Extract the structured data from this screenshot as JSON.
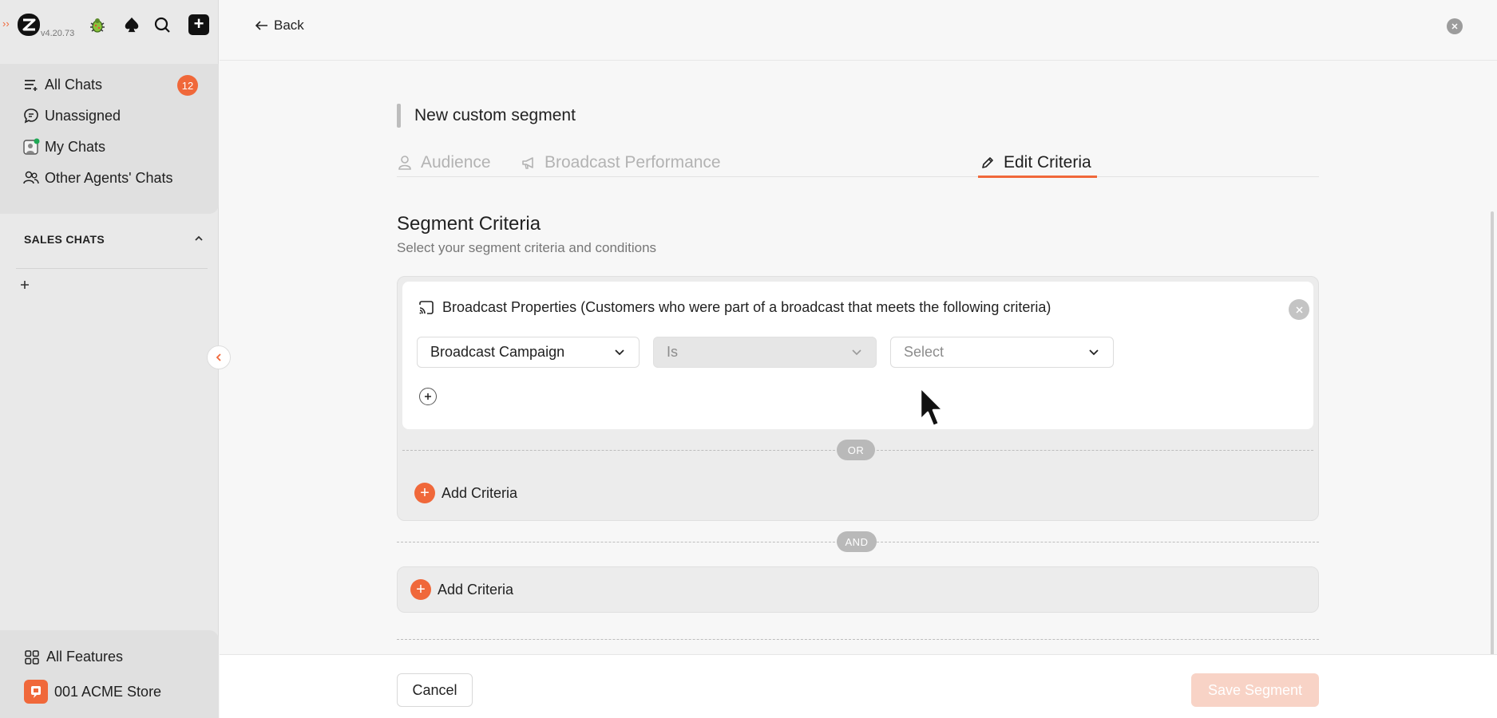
{
  "brand": {
    "version": "v4.20.73",
    "accent": "#f0683a"
  },
  "sidebar": {
    "nav": [
      {
        "label": "All Chats",
        "icon": "all-chats-icon"
      },
      {
        "label": "Unassigned",
        "icon": "unassigned-icon"
      },
      {
        "label": "My Chats",
        "icon": "my-chats-icon"
      },
      {
        "label": "Other Agents' Chats",
        "icon": "agents-icon"
      }
    ],
    "all_chats_badge": "12",
    "section_title": "SALES CHATS",
    "bottom": {
      "features_label": "All Features",
      "store_label": "001 ACME Store"
    }
  },
  "header": {
    "back_label": "Back"
  },
  "segment": {
    "title": "New custom segment",
    "tabs": [
      {
        "label": "Audience",
        "icon": "person-icon",
        "active": false
      },
      {
        "label": "Broadcast Performance",
        "icon": "megaphone-icon",
        "active": false
      },
      {
        "label": "Edit Criteria",
        "icon": "pencil-icon",
        "active": true
      }
    ],
    "criteria_title": "Segment Criteria",
    "criteria_subtitle": "Select your segment criteria and conditions",
    "card": {
      "heading": "Broadcast Properties (Customers who were part of a broadcast that meets the following criteria)",
      "field": "Broadcast Campaign",
      "operator": "Is",
      "value_placeholder": "Select"
    },
    "or_label": "OR",
    "and_label": "AND",
    "add_criteria_label": "Add Criteria"
  },
  "footer": {
    "cancel_label": "Cancel",
    "save_label": "Save Segment"
  }
}
